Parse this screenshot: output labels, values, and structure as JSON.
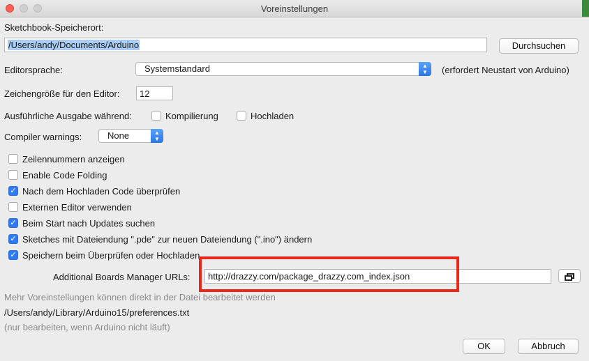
{
  "window": {
    "title": "Voreinstellungen"
  },
  "sketchbook": {
    "label": "Sketchbook-Speicherort:",
    "path": "/Users/andy/Documents/Arduino",
    "browse_label": "Durchsuchen"
  },
  "editor_language": {
    "label": "Editorsprache:",
    "value": "Systemstandard",
    "note": "(erfordert Neustart von Arduino)"
  },
  "font_size": {
    "label": "Zeichengröße für den Editor:",
    "value": "12"
  },
  "verbose": {
    "label": "Ausführliche Ausgabe während:",
    "compile_label": "Kompilierung",
    "compile_checked": false,
    "upload_label": "Hochladen",
    "upload_checked": false
  },
  "compiler_warnings": {
    "label": "Compiler warnings:",
    "value": "None"
  },
  "options": [
    {
      "label": "Zeilennummern anzeigen",
      "checked": false
    },
    {
      "label": "Enable Code Folding",
      "checked": false
    },
    {
      "label": "Nach dem Hochladen Code überprüfen",
      "checked": true
    },
    {
      "label": "Externen Editor verwenden",
      "checked": false
    },
    {
      "label": "Beim Start nach Updates suchen",
      "checked": true
    },
    {
      "label": "Sketches mit Dateiendung \".pde\" zur neuen Dateiendung (\".ino\") ändern",
      "checked": true
    },
    {
      "label": "Speichern beim Überprüfen oder Hochladen",
      "checked": true
    }
  ],
  "boards_manager": {
    "label": "Additional Boards Manager URLs:",
    "url": "http://drazzy.com/package_drazzy.com_index.json"
  },
  "footer": {
    "more_info": "Mehr Voreinstellungen können direkt in der Datei bearbeitet werden",
    "prefs_path": "/Users/andy/Library/Arduino15/preferences.txt",
    "note": "(nur bearbeiten, wenn Arduino nicht läuft)"
  },
  "buttons": {
    "ok": "OK",
    "cancel": "Abbruch"
  },
  "colors": {
    "highlight": "#e8271d",
    "accent": "#2f7bf6"
  },
  "icons": {
    "window_list": "window-list-icon",
    "combo": "chevron-updown-icon"
  }
}
